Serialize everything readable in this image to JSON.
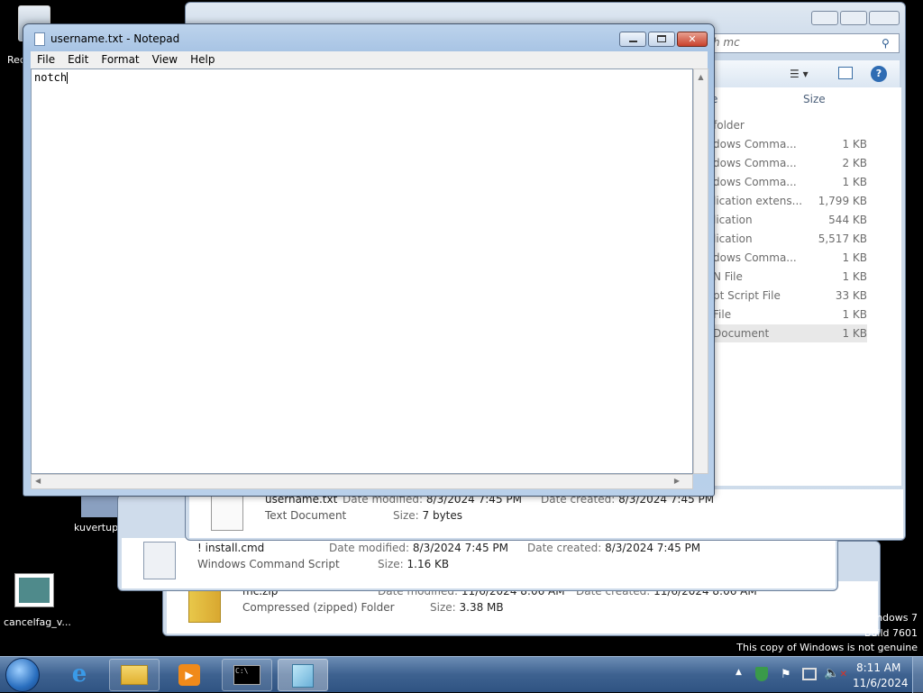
{
  "desktop": {
    "icons": [
      {
        "label": "Rec"
      },
      {
        "label": "kuvertup"
      },
      {
        "label": "cancelfag_v..."
      }
    ],
    "watermark": {
      "line1": "Windows 7",
      "line2": "Build 7601",
      "line3": "This copy of Windows is not genuine"
    }
  },
  "explorer_back": {
    "search_placeholder": "h mc",
    "columns": {
      "name": "e",
      "size": "Size"
    },
    "rows": [
      {
        "type": "folder",
        "size": ""
      },
      {
        "type": "dows Comma...",
        "size": "1 KB"
      },
      {
        "type": "dows Comma...",
        "size": "2 KB"
      },
      {
        "type": "dows Comma...",
        "size": "1 KB"
      },
      {
        "type": "lication extens...",
        "size": "1,799 KB"
      },
      {
        "type": "lication",
        "size": "544 KB"
      },
      {
        "type": "lication",
        "size": "5,517 KB"
      },
      {
        "type": "dows Comma...",
        "size": "1 KB"
      },
      {
        "type": "N File",
        "size": "1 KB"
      },
      {
        "type": "pt Script File",
        "size": "33 KB"
      },
      {
        "type": "File",
        "size": "1 KB"
      },
      {
        "type": "Document",
        "size": "1 KB"
      }
    ]
  },
  "details": [
    {
      "name": "username.txt",
      "type": "Text Document",
      "modified_label": "Date modified:",
      "modified": "8/3/2024 7:45 PM",
      "created_label": "Date created:",
      "created": "8/3/2024 7:45 PM",
      "size_label": "Size:",
      "size": "7 bytes"
    },
    {
      "name": "! install.cmd",
      "type": "Windows Command Script",
      "modified_label": "Date modified:",
      "modified": "8/3/2024 7:45 PM",
      "created_label": "Date created:",
      "created": "8/3/2024 7:45 PM",
      "size_label": "Size:",
      "size": "1.16 KB"
    },
    {
      "name": "mc.zip",
      "type": "Compressed (zipped) Folder",
      "modified_label": "Date modified:",
      "modified": "11/6/2024 8:06 AM",
      "created_label": "Date created:",
      "created": "11/6/2024 8:06 AM",
      "size_label": "Size:",
      "size": "3.38 MB"
    }
  ],
  "notepad": {
    "title": "username.txt - Notepad",
    "menu": [
      "File",
      "Edit",
      "Format",
      "View",
      "Help"
    ],
    "content": "notch"
  },
  "taskbar": {
    "time": "8:11 AM",
    "date": "11/6/2024"
  }
}
